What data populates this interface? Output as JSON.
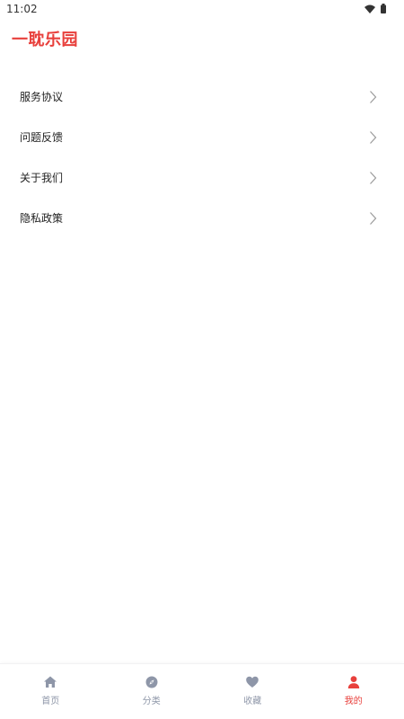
{
  "status_bar": {
    "time": "11:02",
    "icons": [
      "wifi-icon",
      "battery-icon"
    ]
  },
  "header": {
    "title": "一耽乐园"
  },
  "menu": {
    "items": [
      {
        "label": "服务协议",
        "icon": "chevron-right-icon"
      },
      {
        "label": "问题反馈",
        "icon": "chevron-right-icon"
      },
      {
        "label": "关于我们",
        "icon": "chevron-right-icon"
      },
      {
        "label": "隐私政策",
        "icon": "chevron-right-icon"
      }
    ]
  },
  "bottom_nav": {
    "tabs": [
      {
        "label": "首页",
        "icon": "home-icon",
        "active": false
      },
      {
        "label": "分类",
        "icon": "compass-icon",
        "active": false
      },
      {
        "label": "收藏",
        "icon": "heart-icon",
        "active": false
      },
      {
        "label": "我的",
        "icon": "user-icon",
        "active": true
      }
    ]
  },
  "colors": {
    "accent": "#e8403c",
    "nav_inactive": "#8e96a8",
    "text_primary": "#222222",
    "chevron": "#9a9a9a"
  }
}
